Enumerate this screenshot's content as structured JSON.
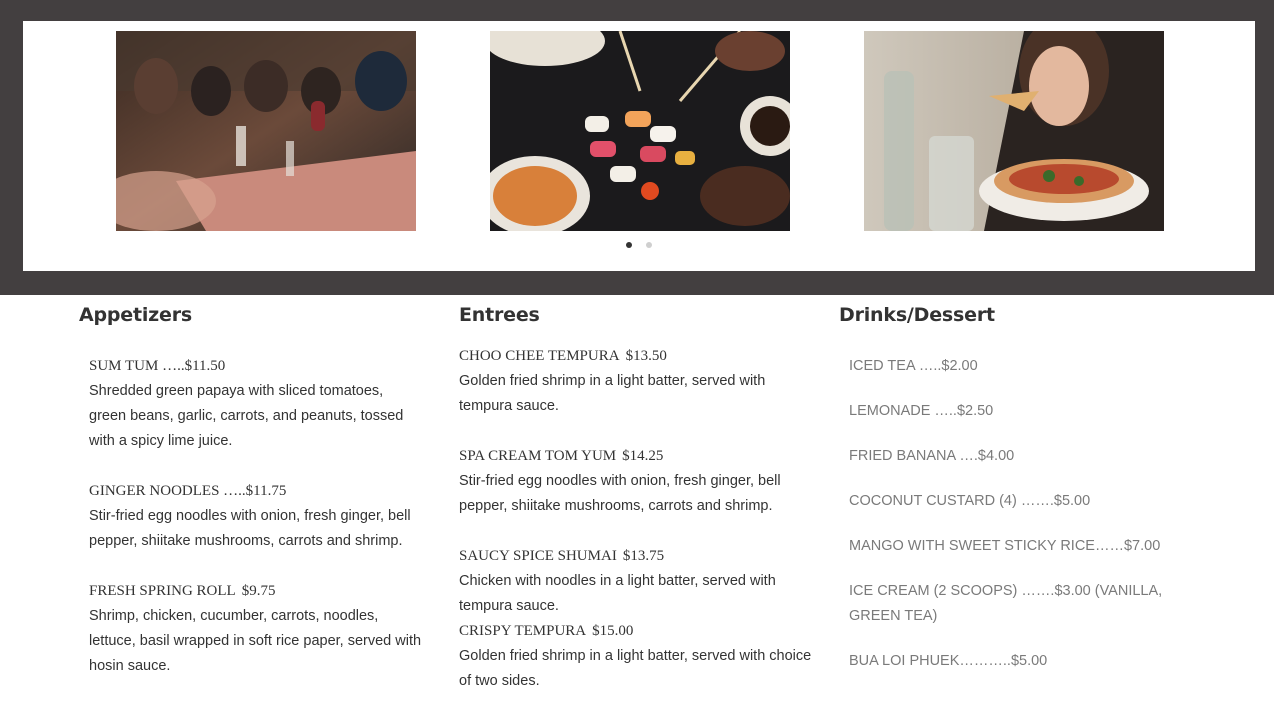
{
  "slider": {
    "slides": [
      {
        "alt": "Friends dining and toasting wine at a restaurant table"
      },
      {
        "alt": "Hands with chopsticks reaching for sushi platter"
      },
      {
        "alt": "Woman eating a slice of pizza"
      }
    ],
    "dots": 2,
    "active_dot": 0
  },
  "menu": {
    "appetizers": {
      "heading": "Appetizers",
      "items": [
        {
          "name": "SUM TUM …..$11.50",
          "price": "",
          "desc": "Shredded green papaya with sliced tomatoes, green beans, garlic, carrots, and peanuts, tossed with a spicy lime juice."
        },
        {
          "name": "GINGER NOODLES …..$11.75",
          "price": "",
          "desc": "Stir-fried egg noodles with onion, fresh ginger, bell pepper, shiitake mushrooms, carrots and shrimp."
        },
        {
          "name": "FRESH SPRING ROLL",
          "price": "$9.75",
          "desc": "Shrimp, chicken, cucumber, carrots, noodles, lettuce, basil wrapped in soft rice paper, served with hosin sauce."
        }
      ]
    },
    "entrees": {
      "heading": "Entrees",
      "items": [
        {
          "name": "CHOO CHEE TEMPURA",
          "price": "$13.50",
          "desc": "Golden fried shrimp in a light batter, served with tempura sauce."
        },
        {
          "name": "SPA CREAM TOM YUM",
          "price": "$14.25",
          "desc": "Stir-fried egg noodles with onion, fresh ginger, bell pepper, shiitake mushrooms, carrots and shrimp."
        },
        {
          "name": "SAUCY SPICE SHUMAI",
          "price": "$13.75",
          "desc": "Chicken with noodles in a light batter, served with tempura sauce."
        },
        {
          "name": "CRISPY TEMPURA",
          "price": "$15.00",
          "desc": "Golden fried shrimp in a light batter, served with choice of two sides."
        }
      ]
    },
    "drinks": {
      "heading": "Drinks/Dessert",
      "items": [
        "ICED TEA …..$2.00",
        "LEMONADE …..$2.50",
        "FRIED BANANA ….$4.00",
        "COCONUT CUSTARD (4) …….$5.00",
        "MANGO WITH SWEET STICKY RICE……$7.00",
        "ICE CREAM (2 SCOOPS) …….$3.00 (VANILLA, GREEN TEA)",
        "BUA LOI PHUEK………..$5.00"
      ]
    }
  }
}
